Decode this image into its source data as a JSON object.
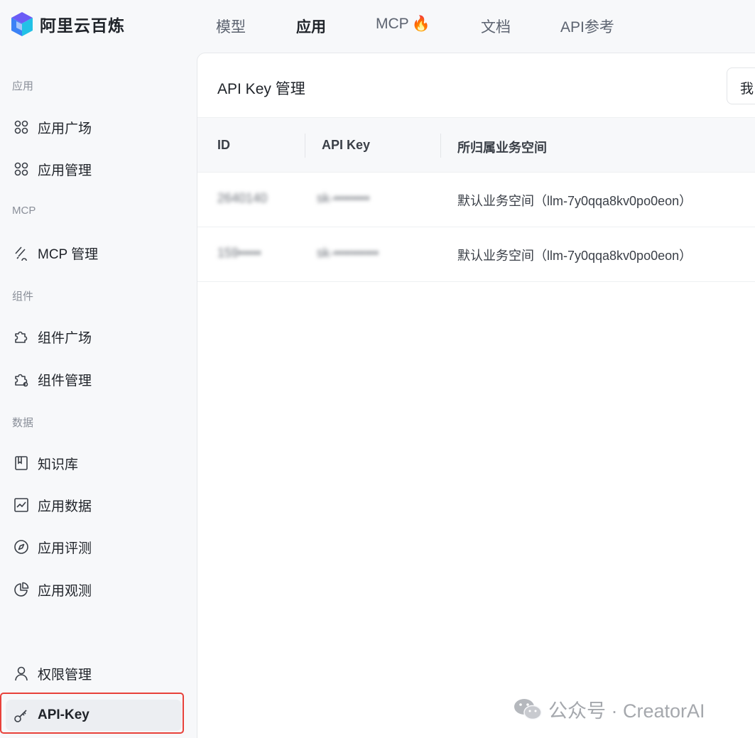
{
  "brand": {
    "name": "阿里云百炼"
  },
  "topnav": [
    {
      "label": "模型"
    },
    {
      "label": "应用",
      "active": true
    },
    {
      "label": "MCP",
      "badge": "🔥"
    },
    {
      "label": "文档"
    },
    {
      "label": "API参考"
    }
  ],
  "sidebar": {
    "sections": [
      "应用",
      "MCP",
      "组件",
      "数据"
    ],
    "items": [
      {
        "label": "应用广场",
        "icon": "grid-icon"
      },
      {
        "label": "应用管理",
        "icon": "grid-icon"
      },
      {
        "label": "MCP 管理",
        "icon": "mcp-icon"
      },
      {
        "label": "组件广场",
        "icon": "puzzle-icon"
      },
      {
        "label": "组件管理",
        "icon": "puzzle-gear-icon"
      },
      {
        "label": "知识库",
        "icon": "book-icon"
      },
      {
        "label": "应用数据",
        "icon": "chart-icon"
      },
      {
        "label": "应用评测",
        "icon": "compass-icon"
      },
      {
        "label": "应用观测",
        "icon": "pie-icon"
      },
      {
        "label": "权限管理",
        "icon": "user-icon"
      },
      {
        "label": "API-Key",
        "icon": "key-icon",
        "active": true
      }
    ]
  },
  "main": {
    "title": "API Key 管理",
    "right_button": "我",
    "table": {
      "headers": [
        "ID",
        "API Key",
        "所归属业务空间"
      ],
      "rows": [
        {
          "id": "2640140",
          "key": "sk-••••••••",
          "workspace": "默认业务空间（llm-7y0qqa8kv0po0eon）"
        },
        {
          "id": "159•••••",
          "key": "sk-••••••••••",
          "workspace": "默认业务空间（llm-7y0qqa8kv0po0eon）"
        }
      ]
    }
  },
  "watermark": {
    "text": "公众号 · CreatorAI"
  },
  "colors": {
    "highlight": "#e8413a",
    "active_bg": "#eceef2",
    "brand_blue": "#4f46e5"
  }
}
